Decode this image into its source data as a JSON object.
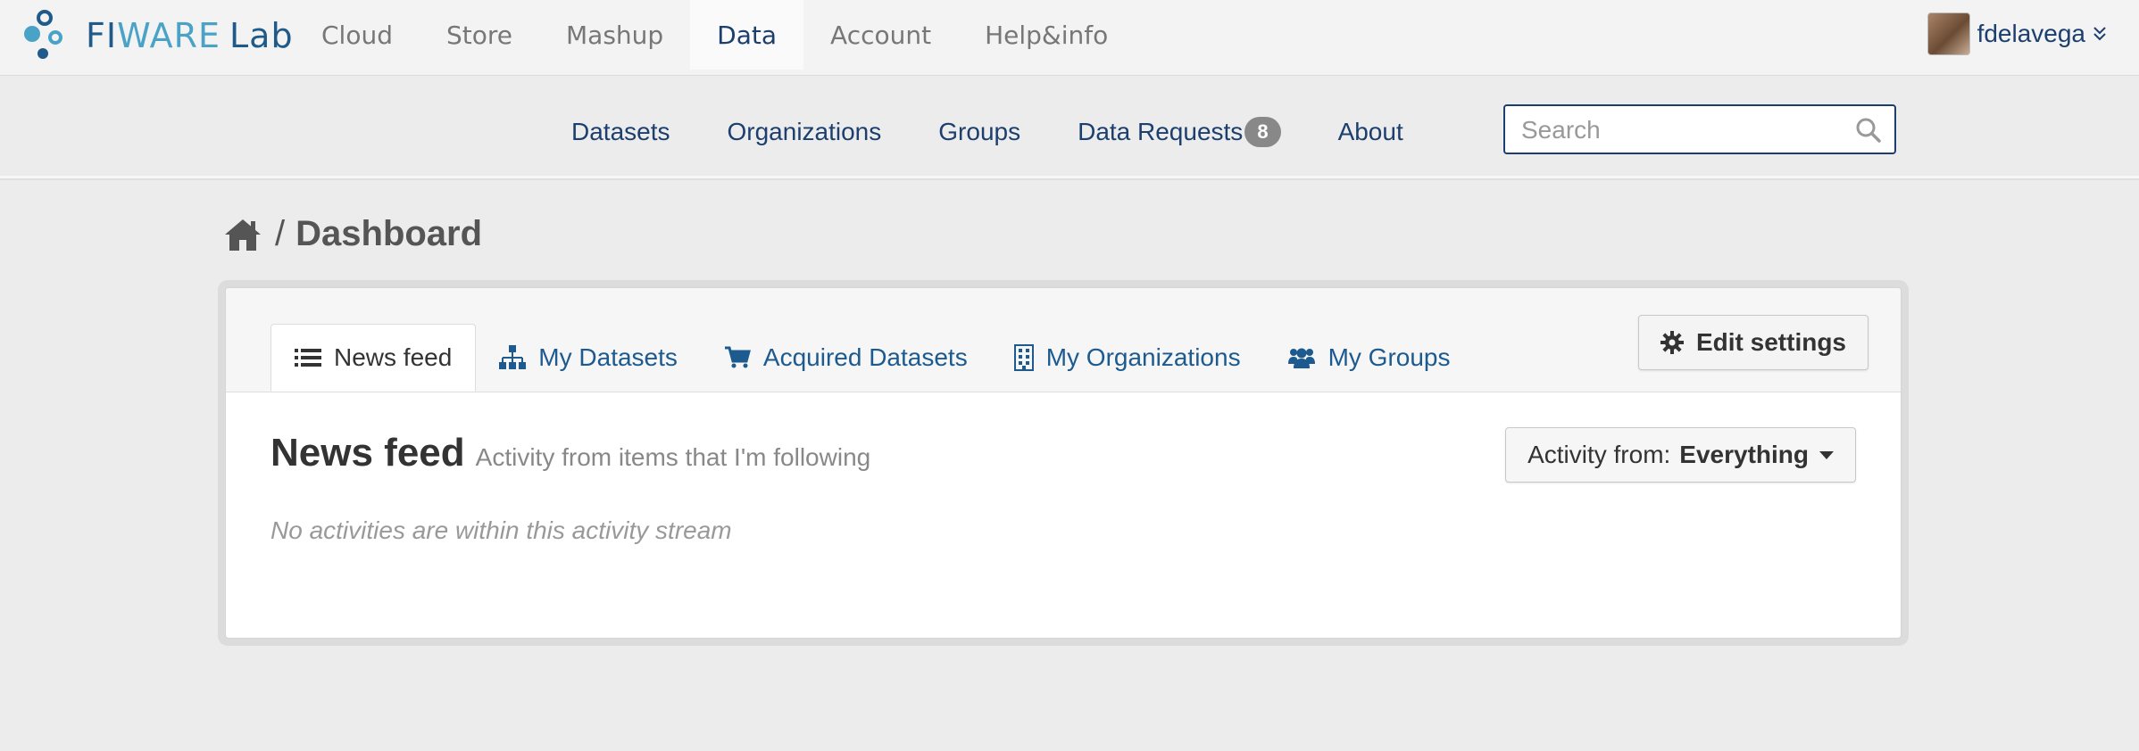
{
  "topbar": {
    "logo": {
      "fi": "FI",
      "wa": "WARE",
      "lab": "Lab"
    },
    "nav": [
      {
        "label": "Cloud",
        "active": false
      },
      {
        "label": "Store",
        "active": false
      },
      {
        "label": "Mashup",
        "active": false
      },
      {
        "label": "Data",
        "active": true
      },
      {
        "label": "Account",
        "active": false
      },
      {
        "label": "Help&info",
        "active": false
      }
    ],
    "user": {
      "name": "fdelavega",
      "menu_icon": "double-chevron-down-icon"
    }
  },
  "subnav": {
    "links": [
      "Datasets",
      "Organizations",
      "Groups",
      "Data Requests",
      "About"
    ],
    "data_requests_count": "8",
    "search": {
      "placeholder": "Search",
      "value": ""
    }
  },
  "breadcrumb": {
    "home_icon": "home-icon",
    "separator": "/",
    "title": "Dashboard"
  },
  "dashboard": {
    "tabs": [
      {
        "label": "News feed",
        "icon": "list-icon",
        "active": true
      },
      {
        "label": "My Datasets",
        "icon": "sitemap-icon",
        "active": false
      },
      {
        "label": "Acquired Datasets",
        "icon": "cart-icon",
        "active": false
      },
      {
        "label": "My Organizations",
        "icon": "building-icon",
        "active": false
      },
      {
        "label": "My Groups",
        "icon": "group-icon",
        "active": false
      }
    ],
    "edit_settings": "Edit settings",
    "feed": {
      "title": "News feed",
      "subtitle": "Activity from items that I'm following",
      "filter_label": "Activity from:",
      "filter_value": "Everything",
      "empty_message": "No activities are within this activity stream"
    }
  },
  "colors": {
    "link": "#1c5a8f",
    "nav_dark": "#1c3f6e",
    "badge": "#888888"
  }
}
